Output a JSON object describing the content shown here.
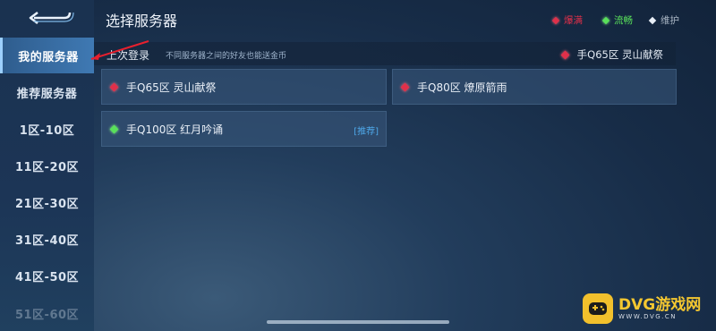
{
  "header": {
    "title": "选择服务器"
  },
  "legend": [
    {
      "label": "爆满",
      "color": "#e0304a",
      "text_color": "#e0304a"
    },
    {
      "label": "流畅",
      "color": "#59e05a",
      "text_color": "#59e05a"
    },
    {
      "label": "维护",
      "color": "#e8eef6",
      "text_color": "#aab6c4"
    }
  ],
  "sidebar": {
    "items": [
      {
        "label": "我的服务器",
        "active": true
      },
      {
        "label": "推荐服务器"
      },
      {
        "label": "1区-10区"
      },
      {
        "label": "11区-20区"
      },
      {
        "label": "21区-30区"
      },
      {
        "label": "31区-40区"
      },
      {
        "label": "41区-50区"
      },
      {
        "label": "51区-60区"
      }
    ]
  },
  "last_login": {
    "title": "上次登录",
    "tip": "不同服务器之间的好友也能送金币",
    "server": "手Q65区 灵山献祭",
    "status_color": "#e0304a"
  },
  "servers": [
    {
      "name": "手Q65区 灵山献祭",
      "status": "爆满",
      "tag": ""
    },
    {
      "name": "手Q80区 燎原箭雨",
      "status": "爆满",
      "tag": ""
    },
    {
      "name": "手Q100区 红月吟诵",
      "status": "流畅",
      "tag": "[推荐]"
    }
  ],
  "watermark": {
    "title": "DVG游戏网",
    "sub": "WWW.DVG.CN"
  }
}
